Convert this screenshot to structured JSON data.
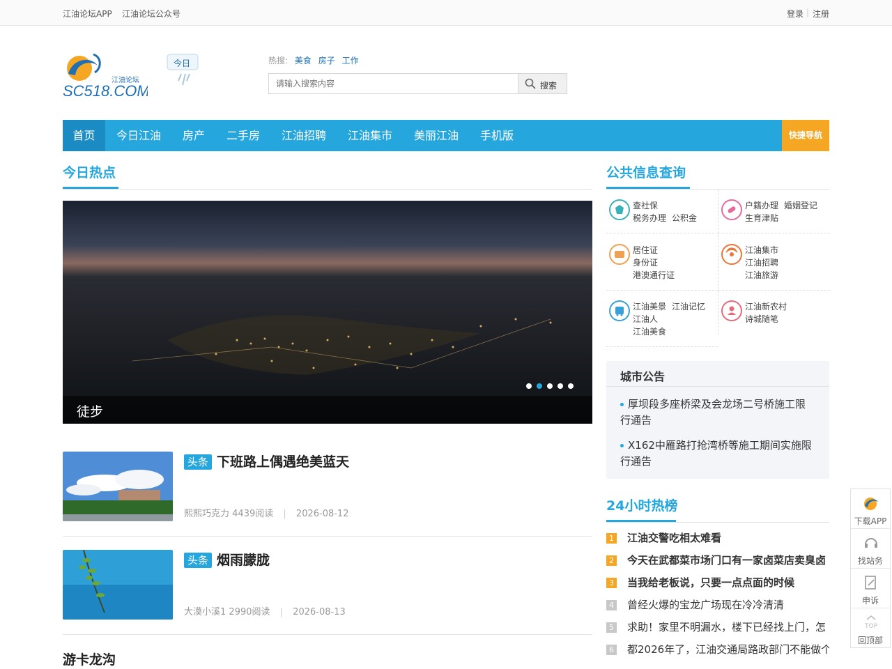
{
  "topbar": {
    "links": [
      "江油论坛APP",
      "江油论坛公众号"
    ],
    "login": "登录",
    "divider": "|",
    "register": "注册"
  },
  "logo": {
    "text": "SC518.COM",
    "sub": "江油论坛"
  },
  "weather": {
    "label": "今日"
  },
  "hot_search": {
    "label": "热搜:",
    "keywords": [
      "美食",
      "房子",
      "工作"
    ]
  },
  "search": {
    "placeholder": "请输入搜索内容",
    "button": "搜索"
  },
  "nav": {
    "items": [
      "首页",
      "今日江油",
      "房产",
      "二手房",
      "江油招聘",
      "江油集市",
      "美丽江油",
      "手机版"
    ],
    "quick": "快捷导航"
  },
  "sections": {
    "today_hot": "今日热点",
    "public_info": "公共信息查询",
    "hot24": "24小时热榜"
  },
  "slider": {
    "caption": "徒步",
    "dots": 5,
    "active_dot": 1
  },
  "news": [
    {
      "tag": "头条",
      "title": "下班路上偶遇绝美蓝天",
      "author": "熙熙巧克力",
      "reads": "4439阅读",
      "date": "2026-08-12",
      "sep": "|"
    },
    {
      "tag": "头条",
      "title": "烟雨朦胧",
      "author": "大漠小溪1",
      "reads": "2990阅读",
      "date": "2026-08-13",
      "sep": "|"
    },
    {
      "title": "游卡龙沟"
    }
  ],
  "public_info": [
    {
      "icon": "shield-icon",
      "color": "#3ab0b8",
      "lines": [
        [
          "查社保"
        ],
        [
          "税务办理",
          "公积金"
        ]
      ]
    },
    {
      "icon": "pill-icon",
      "color": "#e66a9c",
      "lines": [
        [
          "户籍办理",
          "婚姻登记"
        ],
        [
          "生育津贴"
        ]
      ]
    },
    {
      "icon": "card-icon",
      "color": "#f0a050",
      "lines": [
        [
          "居住证"
        ],
        [
          "身份证"
        ],
        [
          "港澳通行证"
        ]
      ]
    },
    {
      "icon": "signal-icon",
      "color": "#e8763a",
      "lines": [
        [
          "江油集市"
        ],
        [
          "江油招聘"
        ],
        [
          "江油旅游"
        ]
      ]
    },
    {
      "icon": "bus-icon",
      "color": "#3aa0d8",
      "lines": [
        [
          "江油美景",
          "江油记忆"
        ],
        [
          "江油人"
        ],
        [
          "江油美食"
        ]
      ]
    },
    {
      "icon": "person-icon",
      "color": "#e66a7c",
      "lines": [
        [
          "江油新农村"
        ],
        [
          "诗城随笔"
        ]
      ]
    }
  ],
  "notice": {
    "title": "城市公告",
    "items": [
      "厚坝段多座桥梁及会龙场二号桥施工限行通告",
      "X162中雁路打抢湾桥等施工期间实施限行通告"
    ]
  },
  "hot24": [
    {
      "n": "1",
      "title": "江油交警吃相太难看"
    },
    {
      "n": "2",
      "title": "今天在武都菜市场门口有一家卤菜店卖臭卤"
    },
    {
      "n": "3",
      "title": "当我给老板说，只要一点点面的时候"
    },
    {
      "n": "4",
      "title": "曾经火爆的宝龙广场现在冷冷清清"
    },
    {
      "n": "5",
      "title": "求助！家里不明漏水，楼下已经找上门，怎"
    },
    {
      "n": "6",
      "title": "都2026年了，江油交通局路政部门不能做个"
    }
  ],
  "float": {
    "items": [
      "下载APP",
      "找站务",
      "申诉",
      "回顶部"
    ],
    "top_text": "TOP"
  },
  "colors": {
    "accent": "#25a6dd",
    "quick_nav": "#f5a623"
  }
}
